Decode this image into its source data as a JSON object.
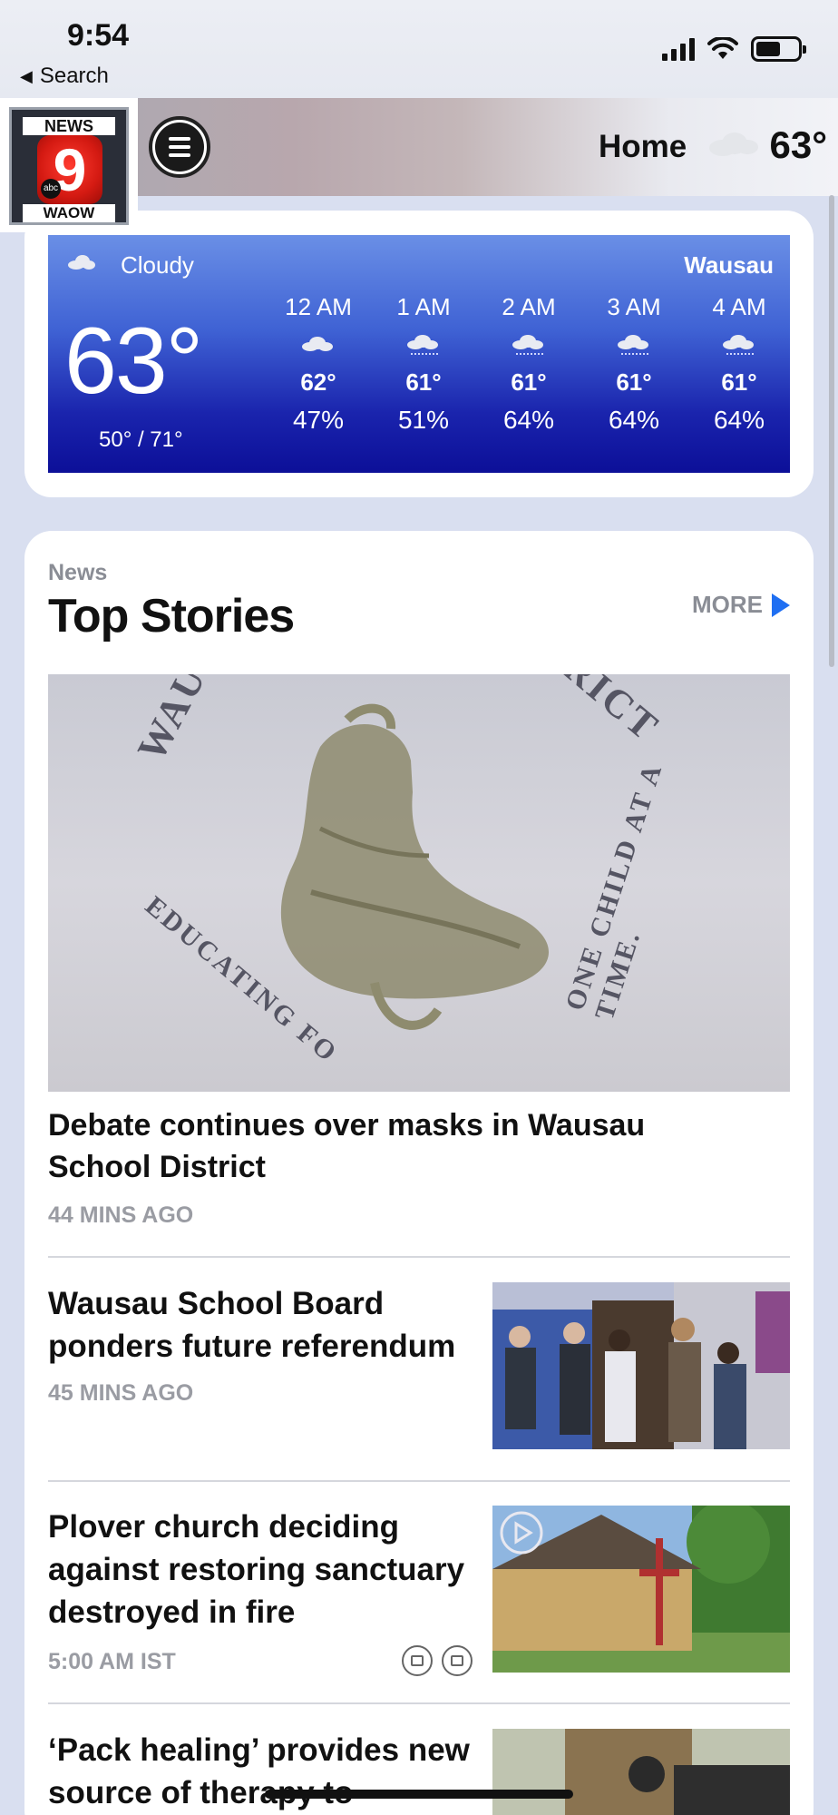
{
  "status_bar": {
    "time": "9:54",
    "back_label": "Search"
  },
  "header": {
    "logo_top": "NEWS",
    "logo_number": "9",
    "logo_network": "abc",
    "logo_bottom": "WAOW",
    "home_label": "Home",
    "temperature": "63°"
  },
  "weather": {
    "condition": "Cloudy",
    "city": "Wausau",
    "current_temp": "63°",
    "range": "50° / 71°",
    "hours": [
      {
        "label": "12 AM",
        "icon": "cloudy-icon",
        "temp": "62°",
        "precip": "47%"
      },
      {
        "label": "1 AM",
        "icon": "rain-icon",
        "temp": "61°",
        "precip": "51%"
      },
      {
        "label": "2 AM",
        "icon": "rain-icon",
        "temp": "61°",
        "precip": "64%"
      },
      {
        "label": "3 AM",
        "icon": "rain-icon",
        "temp": "61°",
        "precip": "64%"
      },
      {
        "label": "4 AM",
        "icon": "rain-icon",
        "temp": "61°",
        "precip": "64%"
      }
    ]
  },
  "stories": {
    "kicker": "News",
    "title": "Top Stories",
    "more_label": "MORE",
    "hero": {
      "headline": "Debate continues over masks in Wausau School District",
      "time": "44 MINS AGO",
      "image_text_top": "WAUSAU SC",
      "image_text_right": "RICT",
      "image_text_side": "ONE CHILD AT A TIME.",
      "image_text_bottom": "EDUCATING FO"
    },
    "items": [
      {
        "headline": "Wausau School Board ponders future referendum",
        "time": "45 MINS AGO"
      },
      {
        "headline": "Plover church deciding against restoring sanctuary destroyed in fire",
        "time": "5:00 AM IST"
      },
      {
        "headline": "‘Pack healing’ provides new source of therapy to",
        "time": ""
      }
    ]
  }
}
